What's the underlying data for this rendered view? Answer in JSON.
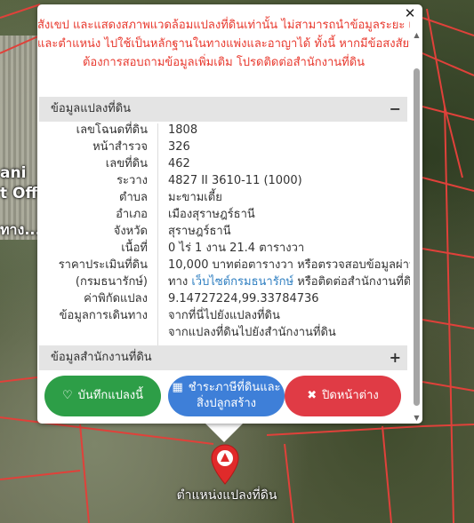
{
  "popup": {
    "warning_lines": [
      "สังเขป และแสดงสภาพแวดล้อมแปลงที่ดินเท่านั้น ไม่สามารถนำข้อมูลระยะ เนื้อที่",
      "และตำแหน่ง ไปใช้เป็นหลักฐานในทางแพ่งและอาญาได้ ทั้งนี้ หากมีข้อสงสัยหรือ",
      "ต้องการสอบถามข้อมูลเพิ่มเติม โปรดติดต่อสำนักงานที่ดิน"
    ],
    "section_parcel": "ข้อมูลแปลงที่ดิน",
    "section_office": "ข้อมูลสำนักงานที่ดิน",
    "rows": [
      {
        "label": "เลขโฉนดที่ดิน",
        "value": "1808"
      },
      {
        "label": "หน้าสำรวจ",
        "value": "326"
      },
      {
        "label": "เลขที่ดิน",
        "value": "462"
      },
      {
        "label": "ระวาง",
        "value": "4827 II 3610-11 (1000)"
      },
      {
        "label": "ตำบล",
        "value": "มะขามเตี้ย"
      },
      {
        "label": "อำเภอ",
        "value": "เมืองสุราษฎร์ธานี"
      },
      {
        "label": "จังหวัด",
        "value": "สุราษฎร์ธานี"
      },
      {
        "label": "เนื้อที่",
        "value": "0 ไร่ 1 งาน 21.4 ตารางวา"
      }
    ],
    "price_label_1": "ราคาประเมินที่ดิน",
    "price_label_2": "(กรมธนารักษ์)",
    "price_value_1": "10,000 บาทต่อตารางวา หรือตรวจสอบข้อมูลผ่าน",
    "price_value_2a": "ทาง ",
    "price_link": "เว็บไซต์กรมธนารักษ์",
    "price_value_2b": " หรือติดต่อสำนักงานที่ดิน",
    "coord_label": "ค่าพิกัดแปลง",
    "coord_value": "9.14727224,99.33784736",
    "travel_label": "ข้อมูลการเดินทาง",
    "travel_link_1": "จากที่นี่ไปยังแปลงที่ดิน",
    "travel_link_2": "จากแปลงที่ดินไปยังสำนักงานที่ดิน",
    "buttons": {
      "save": "บันทึกแปลงนี้",
      "check_1": "ชำระภาษีที่ดินและ",
      "check_2": "สิ่งปลูกสร้าง",
      "close": "ปิดหน้าต่าง"
    }
  },
  "map": {
    "labels": [
      "ani",
      "t Off",
      "ทาง..."
    ],
    "marker_caption": "ตำแหน่งแปลงที่ดิน"
  },
  "colors": {
    "warning": "#e8392e",
    "link": "#2f7fc1",
    "save": "#2d9e47",
    "check": "#3e7fd8",
    "close": "#e03b45"
  }
}
